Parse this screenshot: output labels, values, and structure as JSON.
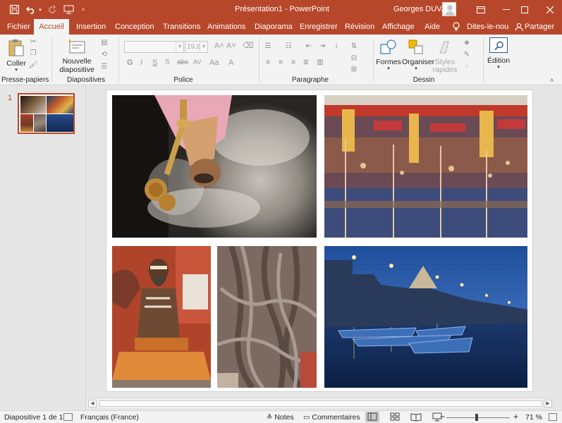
{
  "titlebar": {
    "title": "Présentation1  -  PowerPoint",
    "user": "Georges DUVAL",
    "icons": [
      "save-icon",
      "undo-icon",
      "redo-icon",
      "start-from-beginning-icon",
      "customize-qat-icon"
    ]
  },
  "tabs": [
    "Fichier",
    "Accueil",
    "Insertion",
    "Conception",
    "Transitions",
    "Animations",
    "Diaporama",
    "Enregistrer",
    "Révision",
    "Affichage",
    "Aide"
  ],
  "tell_me": "Dites-le-nou",
  "share": "Partager",
  "ribbon": {
    "clipboard": {
      "paste": "Coller",
      "group": "Presse-papiers"
    },
    "slides": {
      "new_slide_line1": "Nouvelle",
      "new_slide_line2": "diapositive",
      "group": "Diapositives"
    },
    "font": {
      "font_name": "",
      "font_size": "19,8",
      "group": "Police"
    },
    "paragraph": {
      "group": "Paragraphe"
    },
    "drawing": {
      "shapes": "Formes",
      "arrange": "Organiser",
      "styles_line1": "Styles",
      "styles_line2": "rapides",
      "group": "Dessin"
    },
    "editing": {
      "label": "Édition"
    }
  },
  "thumbnail": {
    "slide_number": "1"
  },
  "status": {
    "slide_info": "Diapositive 1 de 1",
    "language": "Français (France)",
    "notes": "Notes",
    "comments": "Commentaires",
    "zoom_minus": "−",
    "zoom_plus": "+",
    "zoom": "71 %"
  },
  "colors": {
    "accent": "#b7472a",
    "ribbon": "#f3f3f3"
  }
}
